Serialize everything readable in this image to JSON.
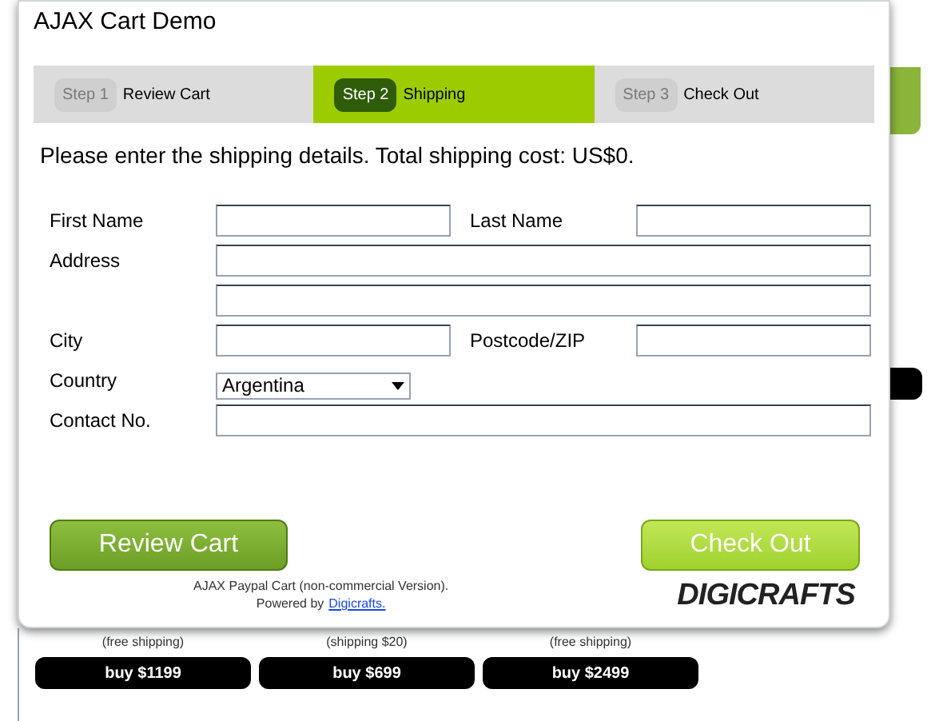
{
  "window": {
    "title": "AJAX Cart Demo"
  },
  "steps": [
    {
      "badge": "Step 1",
      "label": "Review Cart",
      "selected": false
    },
    {
      "badge": "Step 2",
      "label": "Shipping",
      "selected": true
    },
    {
      "badge": "Step 3",
      "label": "Check Out",
      "selected": false
    }
  ],
  "instruction": "Please enter the shipping details. Total shipping cost: US$0.",
  "form": [
    {
      "kind": "pair",
      "fields": [
        {
          "label": "First Name"
        },
        {
          "label": "Last Name"
        }
      ]
    },
    {
      "kind": "wide",
      "fields": [
        {
          "label": "Address"
        }
      ]
    },
    {
      "kind": "wide"
    },
    {
      "kind": "pair",
      "fields": [
        {
          "label": "City"
        },
        {
          "label": "Postcode/ZIP"
        }
      ]
    },
    {
      "kind": "select",
      "fields": [
        {
          "label": "Country",
          "value": "Argentina"
        }
      ]
    },
    {
      "kind": "wide",
      "fields": [
        {
          "label": "Contact No."
        }
      ]
    }
  ],
  "buttons": [
    {
      "label": "Review Cart",
      "kind": "back"
    },
    {
      "label": "Check Out",
      "kind": "next"
    }
  ],
  "footer": {
    "text": "AJAX Paypal Cart (non-commercial Version).",
    "powered": "Powered by",
    "link": "Digicrafts.",
    "logo": "DIGICRAFTS"
  },
  "products": [
    {
      "note": "(free shipping)",
      "buy": "buy $1199"
    },
    {
      "note": "(shipping $20)",
      "buy": "buy $699"
    },
    {
      "note": "(free shipping)",
      "buy": "buy $2499"
    }
  ]
}
